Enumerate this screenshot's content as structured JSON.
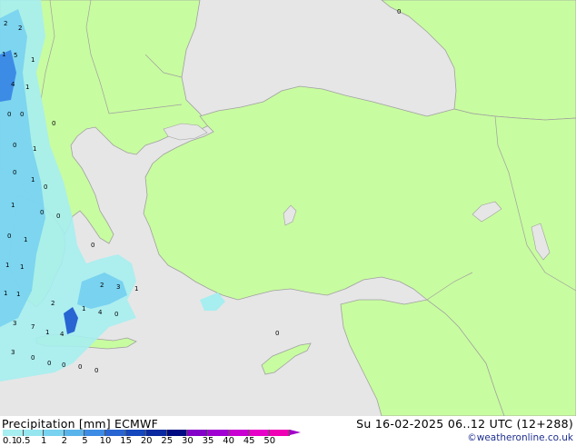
{
  "map": {
    "title": "Precipitation [mm]",
    "model": "ECMWF",
    "valid_time": "Su 16-02-2025 06..12 UTC (12+288)",
    "credit": "©weatheronline.co.uk",
    "colors": {
      "sea": "#e6e6e6",
      "land": "#c8fca0",
      "coast": "#a0a0a0",
      "precip_light": "#a6eef0",
      "precip_medium": "#78d2f0",
      "precip_heavy": "#3c8ce6"
    },
    "legend": {
      "labels": [
        "0.1",
        "0.5",
        "1",
        "2",
        "5",
        "10",
        "15",
        "20",
        "25",
        "30",
        "35",
        "40",
        "45",
        "50"
      ],
      "colors": [
        "#a6eef0",
        "#96e6f0",
        "#78d2f0",
        "#5ab4ec",
        "#3c8ce6",
        "#2864d2",
        "#1446be",
        "#0a28a0",
        "#000a82",
        "#8200c8",
        "#a000d2",
        "#c800d2",
        "#e600c8",
        "#f000b4"
      ]
    },
    "point_values": [
      {
        "v": "2",
        "id": "p1"
      },
      {
        "v": "2",
        "id": "p2"
      },
      {
        "v": "1",
        "id": "p3"
      },
      {
        "v": "5",
        "id": "p4"
      },
      {
        "v": "1",
        "id": "p5"
      },
      {
        "v": "4",
        "id": "p6"
      },
      {
        "v": "1",
        "id": "p7"
      },
      {
        "v": "0",
        "id": "p8"
      },
      {
        "v": "0",
        "id": "p9"
      },
      {
        "v": "0",
        "id": "p10"
      },
      {
        "v": "0",
        "id": "p11"
      },
      {
        "v": "1",
        "id": "p12"
      },
      {
        "v": "0",
        "id": "p13"
      },
      {
        "v": "1",
        "id": "p14"
      },
      {
        "v": "0",
        "id": "p15"
      },
      {
        "v": "1",
        "id": "p16"
      },
      {
        "v": "0",
        "id": "p17"
      },
      {
        "v": "0",
        "id": "p18"
      },
      {
        "v": "0",
        "id": "p19"
      },
      {
        "v": "1",
        "id": "p20"
      },
      {
        "v": "1",
        "id": "p21"
      },
      {
        "v": "1",
        "id": "p22"
      },
      {
        "v": "0",
        "id": "p23"
      },
      {
        "v": "1",
        "id": "p24"
      },
      {
        "v": "2",
        "id": "p25"
      },
      {
        "v": "3",
        "id": "p26"
      },
      {
        "v": "1",
        "id": "p27"
      },
      {
        "v": "3",
        "id": "p28"
      },
      {
        "v": "7",
        "id": "p29"
      },
      {
        "v": "1",
        "id": "p30"
      },
      {
        "v": "4",
        "id": "p31"
      },
      {
        "v": "1",
        "id": "p32"
      },
      {
        "v": "4",
        "id": "p33"
      },
      {
        "v": "0",
        "id": "p34"
      },
      {
        "v": "2",
        "id": "p35"
      },
      {
        "v": "3",
        "id": "p36"
      },
      {
        "v": "0",
        "id": "p37"
      },
      {
        "v": "0",
        "id": "p38"
      },
      {
        "v": "0",
        "id": "p39"
      },
      {
        "v": "0",
        "id": "p40"
      },
      {
        "v": "0",
        "id": "p41"
      },
      {
        "v": "0",
        "id": "p42"
      },
      {
        "v": "1",
        "id": "p43"
      },
      {
        "v": "0",
        "id": "p44"
      }
    ]
  }
}
